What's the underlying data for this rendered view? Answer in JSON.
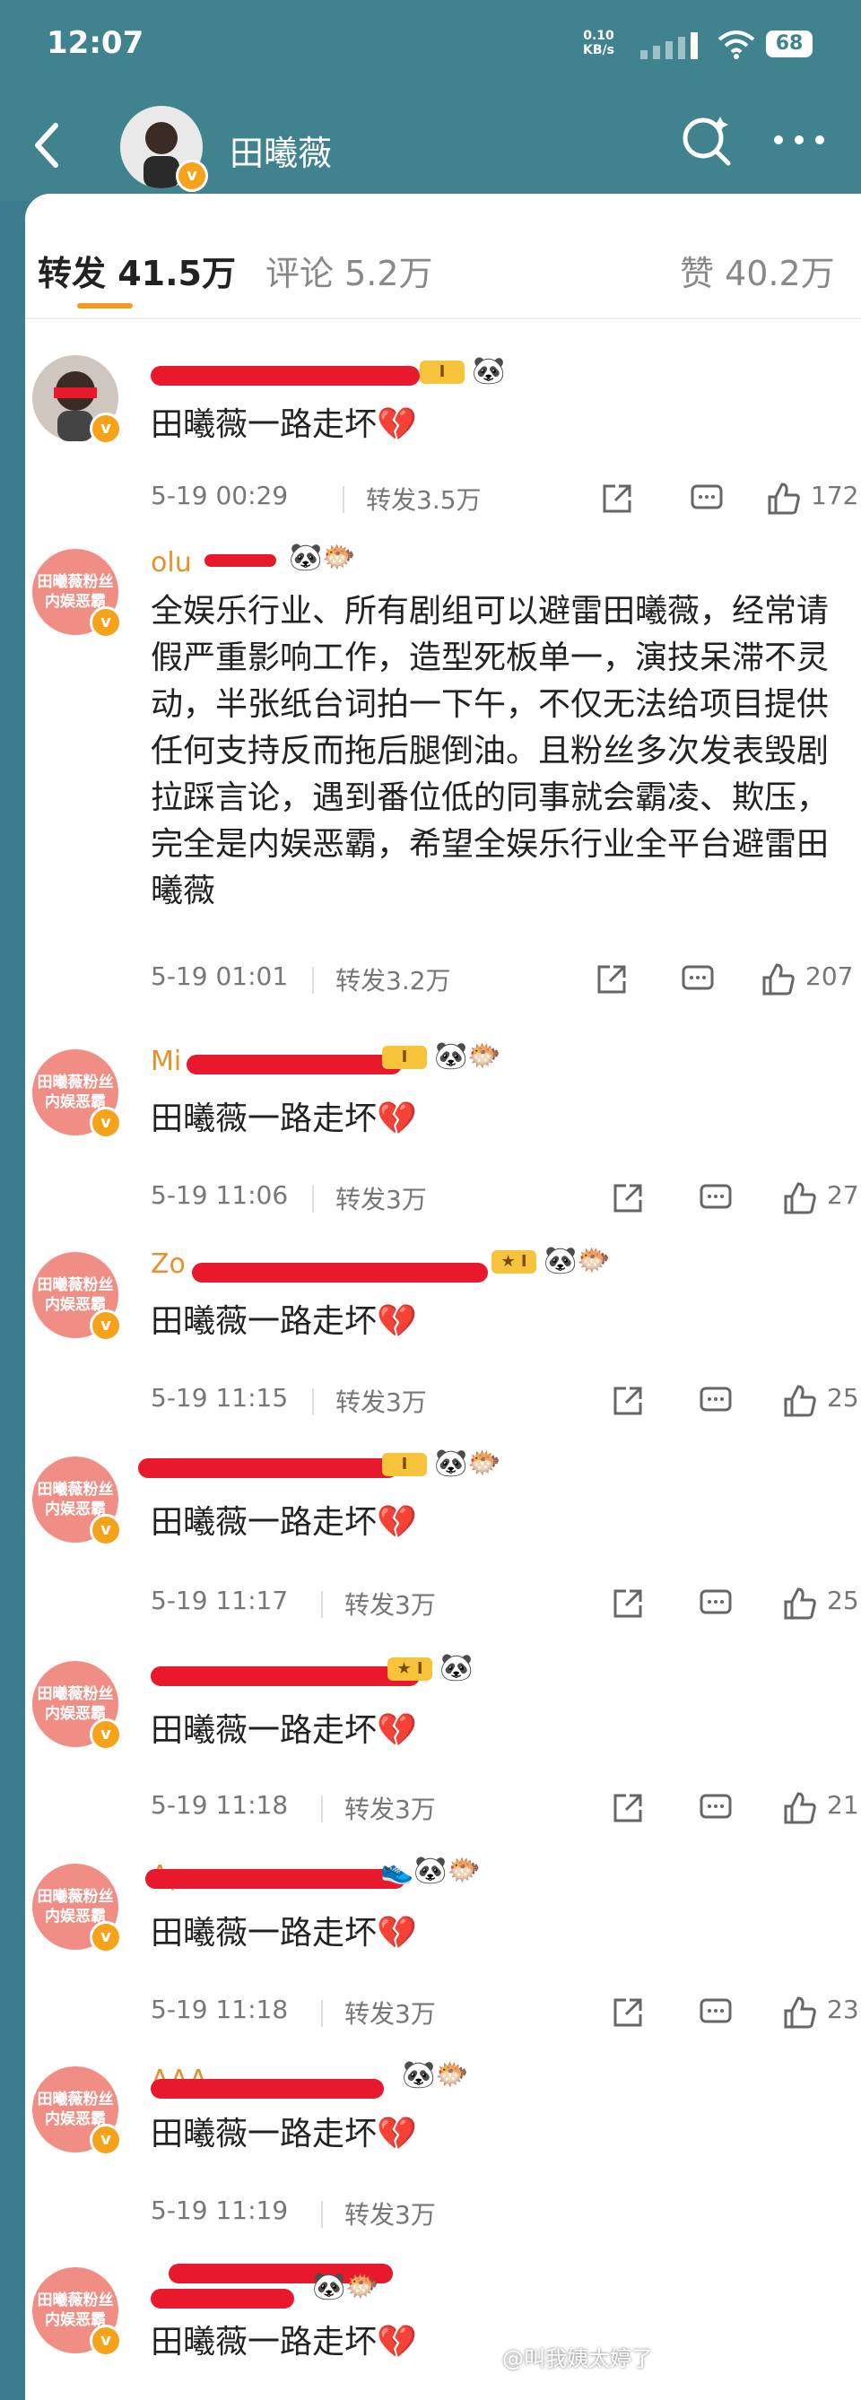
{
  "status_bar": {
    "time": "12:07",
    "net_speed": "0.10",
    "net_unit": "KB/s",
    "battery": "68"
  },
  "header": {
    "title": "田曦薇"
  },
  "tabs": [
    {
      "label": "转发 41.5万"
    },
    {
      "label": "评论 5.2万"
    },
    {
      "label": "赞 40.2万"
    }
  ],
  "colors": {
    "accent": "#f39a20",
    "header_bg": "#41828f",
    "username": "#e8902a",
    "fan_avatar": "#f08e85"
  },
  "fan_avatar_text": "田曦薇粉丝内娱恶霸",
  "posts": [
    {
      "username": "",
      "content": "田曦薇一路走坏💔",
      "time": "5-19 00:29",
      "repost": "转发3.5万",
      "likes": "172"
    },
    {
      "username": "olu",
      "content": "全娱乐行业、所有剧组可以避雷田曦薇，经常请假严重影响工作，造型死板单一，演技呆滞不灵动，半张纸台词拍一下午，不仅无法给项目提供任何支持反而拖后腿倒油。且粉丝多次发表毁剧拉踩言论，遇到番位低的同事就会霸凌、欺压，完全是内娱恶霸，希望全娱乐行业全平台避雷田曦薇",
      "time": "5-19 01:01",
      "repost": "转发3.2万",
      "likes": "207"
    },
    {
      "username": "Mi",
      "content": "田曦薇一路走坏💔",
      "time": "5-19 11:06",
      "repost": "转发3万",
      "likes": "27"
    },
    {
      "username": "Zo",
      "content": "田曦薇一路走坏💔",
      "time": "5-19 11:15",
      "repost": "转发3万",
      "likes": "25"
    },
    {
      "username": "",
      "content": "田曦薇一路走坏💔",
      "time": "5-19 11:17",
      "repost": "转发3万",
      "likes": "25"
    },
    {
      "username": "",
      "content": "田曦薇一路走坏💔",
      "time": "5-19 11:18",
      "repost": "转发3万",
      "likes": "21"
    },
    {
      "username": "Ap",
      "content": "田曦薇一路走坏💔",
      "time": "5-19 11:18",
      "repost": "转发3万",
      "likes": "23"
    },
    {
      "username": "AAA",
      "content": "田曦薇一路走坏💔",
      "time": "5-19 11:19",
      "repost": "转发3万",
      "likes": ""
    },
    {
      "username": "",
      "content": "田曦薇一路走坏💔",
      "time": "",
      "repost": "",
      "likes": ""
    }
  ],
  "watermark": "@叫我姨太婷了"
}
